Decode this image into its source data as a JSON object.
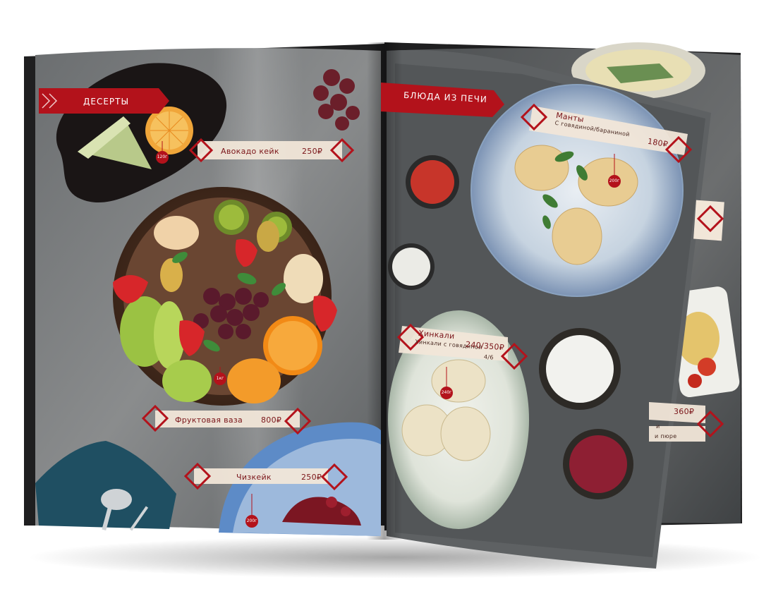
{
  "left_page": {
    "section_title": "ДЕСЕРТЫ",
    "items": [
      {
        "name": "Авокадо кейк",
        "price": "250₽",
        "weight": "120г"
      },
      {
        "name": "Фруктовая ваза",
        "price": "800₽",
        "weight": "1кг"
      },
      {
        "name": "Чизкейк",
        "price": "250₽",
        "weight": "200г"
      }
    ]
  },
  "right_page": {
    "section_title": "БЛЮДА ИЗ ПЕЧИ",
    "items": [
      {
        "name": "Манты",
        "subtitle": "С говядиной/бараниной",
        "price": "180₽",
        "weight": "200г"
      },
      {
        "name": "Хинкали",
        "subtitle": "Хинкали с говядиной",
        "price": "240/350₽",
        "portion": "4/6",
        "weight": "240г"
      },
      {
        "partial_subtitle_1": "и",
        "partial_subtitle_2": "и пюре",
        "price": "360₽"
      }
    ]
  },
  "colors": {
    "accent_red": "#b3121b",
    "label_band": "#f1e6d8",
    "slate": "#5b5e60"
  }
}
